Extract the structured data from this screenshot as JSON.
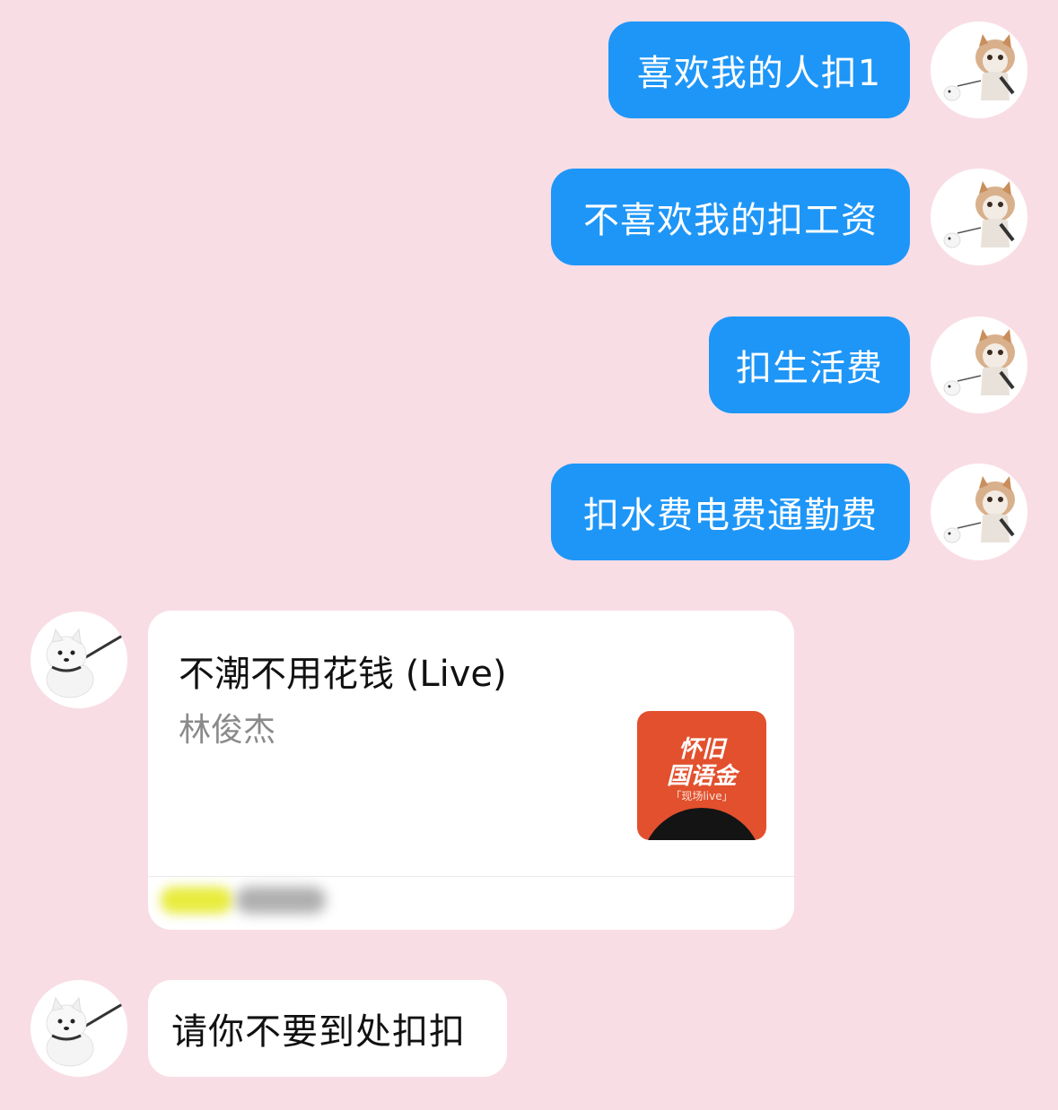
{
  "outgoing_messages": [
    {
      "text": "喜欢我的人扣1"
    },
    {
      "text": "不喜欢我的扣工资"
    },
    {
      "text": "扣生活费"
    },
    {
      "text": "扣水费电费通勤费"
    }
  ],
  "music_card": {
    "title": "不潮不用花钱 (Live)",
    "artist": "林俊杰",
    "cover_line1": "怀旧",
    "cover_line2": "国语金",
    "cover_tag": "「现场live」"
  },
  "incoming_message": {
    "text": "请你不要到处扣扣"
  },
  "colors": {
    "background": "#f9dde5",
    "outgoing_bubble": "#1e96f7",
    "incoming_bubble": "#ffffff",
    "cover": "#e2502e"
  },
  "icons": {
    "self_avatar": "cat-walking-dog-avatar",
    "other_avatar": "white-samoyed-dog-avatar"
  }
}
